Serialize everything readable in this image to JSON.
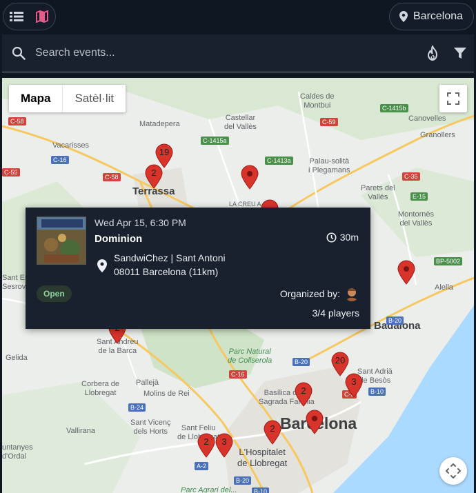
{
  "header": {
    "location_label": "Barcelona"
  },
  "search": {
    "placeholder": "Search events...",
    "value": ""
  },
  "map": {
    "type_options": [
      "Mapa",
      "Satèl·lit"
    ],
    "selected_type": "Mapa",
    "labels": {
      "terrassa": "Terrassa",
      "barcelona": "Barcelona",
      "badalona": "Badalona",
      "hospitalet": "L'Hospitalet\nde Llobregat",
      "matadepera": "Matadepera",
      "castellar": "Castellar\ndel Vallès",
      "caldes": "Caldes de\nMontbui",
      "canovelles": "Canovelles",
      "granollers": "Granollers",
      "vacarisses": "Vacarisses",
      "palau": "Palau-solità\ni Plegamans",
      "parets": "Parets del\nVallès",
      "montornes": "Montornès\ndel Vallès",
      "alella": "Alella",
      "creu": "LA CREU A",
      "santandreu": "Sant Andreu\nde la Barca",
      "gelida": "Gelida",
      "corbera": "Corbera de\nLlobregat",
      "palleja": "Pallejà",
      "molins": "Molins de Rei",
      "collserola": "Parc Natural\nde Collserola",
      "vallirana": "Vallirana",
      "santvicenc": "Sant Vicenç\ndels Horts",
      "santfeliu": "Sant Feliu\nde Llobregat",
      "santadria": "Sant Adrià\nde Besòs",
      "basilica": "Basílica de la\nSagrada Família",
      "santesteve": "Sant Este\nSesrov",
      "untanyes": "untanyes\nd'Ordal",
      "parcagrari": "Parc Agrari del..."
    },
    "roads": [
      "C-58",
      "C-16",
      "C-55",
      "C-58",
      "C-1415a",
      "C-1413a",
      "C-59",
      "C-1415b",
      "C-35",
      "E-15",
      "BP-5002",
      "B-20",
      "B-20",
      "C-16",
      "B-10",
      "B-24",
      "A-2",
      "B-20",
      "B-10",
      "C-3"
    ],
    "pins": [
      "19",
      "2",
      "",
      "",
      "",
      "2",
      "20",
      "2",
      "3",
      "2",
      "",
      "2",
      "3"
    ]
  },
  "event": {
    "date": "Wed Apr 15, 6:30 PM",
    "title": "Dominion",
    "duration": "30m",
    "venue": "SandwiChez | Sant Antoni",
    "address": "08011 Barcelona (11km)",
    "status": "Open",
    "organizer_label": "Organized by:",
    "players": "3/4 players"
  },
  "colors": {
    "pin": "#c5221f",
    "accent_map_icon": "#e85a8a",
    "status_bg": "#2a3a30",
    "status_text": "#8fd19e"
  },
  "icons": [
    "list-icon",
    "map-icon",
    "location-pin-icon",
    "search-icon",
    "fire-icon",
    "filter-icon",
    "fullscreen-icon",
    "clock-icon",
    "recenter-icon"
  ]
}
